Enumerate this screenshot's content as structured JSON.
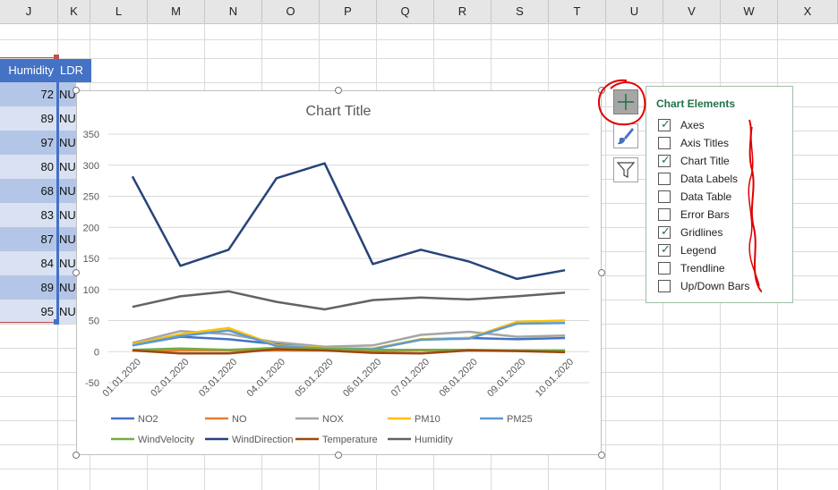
{
  "columns": [
    "J",
    "K",
    "L",
    "M",
    "N",
    "O",
    "P",
    "Q",
    "R",
    "S",
    "T",
    "U",
    "V",
    "W",
    "X"
  ],
  "table": {
    "headers": [
      "Humidity",
      "LDR"
    ],
    "humidity": [
      "72",
      "89",
      "97",
      "80",
      "68",
      "83",
      "87",
      "84",
      "89",
      "95"
    ],
    "ldr": [
      "NU",
      "NU",
      "NU",
      "NU",
      "NU",
      "NU",
      "NU",
      "NU",
      "NU",
      "NU"
    ]
  },
  "chart_data": {
    "type": "line",
    "title": "Chart Title",
    "categories": [
      "01.01.2020",
      "02.01.2020",
      "03.01.2020",
      "04.01.2020",
      "05.01.2020",
      "06.01.2020",
      "07.01.2020",
      "08.01.2020",
      "09.01.2020",
      "10.01.2020"
    ],
    "ylim": [
      -50,
      350
    ],
    "yticks": [
      -50,
      0,
      50,
      100,
      150,
      200,
      250,
      300,
      350
    ],
    "grid": true,
    "legend_position": "bottom",
    "series": [
      {
        "name": "NO2",
        "color": "#4472c4",
        "values": [
          10,
          24,
          20,
          12,
          6,
          4,
          20,
          22,
          20,
          22
        ]
      },
      {
        "name": "NO",
        "color": "#ed7d31",
        "values": [
          2,
          2,
          2,
          2,
          2,
          1,
          2,
          2,
          2,
          2
        ]
      },
      {
        "name": "NOX",
        "color": "#a5a5a5",
        "values": [
          14,
          33,
          28,
          15,
          8,
          10,
          27,
          32,
          24,
          26
        ]
      },
      {
        "name": "PM10",
        "color": "#ffc000",
        "values": [
          12,
          28,
          38,
          10,
          6,
          5,
          20,
          22,
          48,
          50
        ]
      },
      {
        "name": "PM25",
        "color": "#5b9bd5",
        "values": [
          10,
          25,
          34,
          9,
          5,
          4,
          19,
          21,
          45,
          46
        ]
      },
      {
        "name": "WindVelocity",
        "color": "#70ad47",
        "values": [
          3,
          5,
          3,
          6,
          5,
          3,
          3,
          3,
          2,
          2
        ]
      },
      {
        "name": "WindDirection",
        "color": "#264478",
        "values": [
          282,
          138,
          164,
          279,
          303,
          141,
          164,
          145,
          117,
          131
        ]
      },
      {
        "name": "Temperature",
        "color": "#9e480e",
        "values": [
          2,
          -3,
          -3,
          4,
          2,
          -2,
          -3,
          2,
          1,
          -1
        ]
      },
      {
        "name": "Humidity",
        "color": "#636363",
        "values": [
          72,
          89,
          97,
          80,
          68,
          83,
          87,
          84,
          89,
          95
        ]
      }
    ]
  },
  "side_buttons": {
    "elements": "plus-icon",
    "styles": "brush-icon",
    "filters": "funnel-icon"
  },
  "chart_elements_panel": {
    "title": "Chart Elements",
    "options": [
      {
        "label": "Axes",
        "checked": true
      },
      {
        "label": "Axis Titles",
        "checked": false
      },
      {
        "label": "Chart Title",
        "checked": true
      },
      {
        "label": "Data Labels",
        "checked": false
      },
      {
        "label": "Data Table",
        "checked": false
      },
      {
        "label": "Error Bars",
        "checked": false
      },
      {
        "label": "Gridlines",
        "checked": true
      },
      {
        "label": "Legend",
        "checked": true
      },
      {
        "label": "Trendline",
        "checked": false
      },
      {
        "label": "Up/Down Bars",
        "checked": false
      }
    ]
  },
  "annotation_color": "#e00000"
}
